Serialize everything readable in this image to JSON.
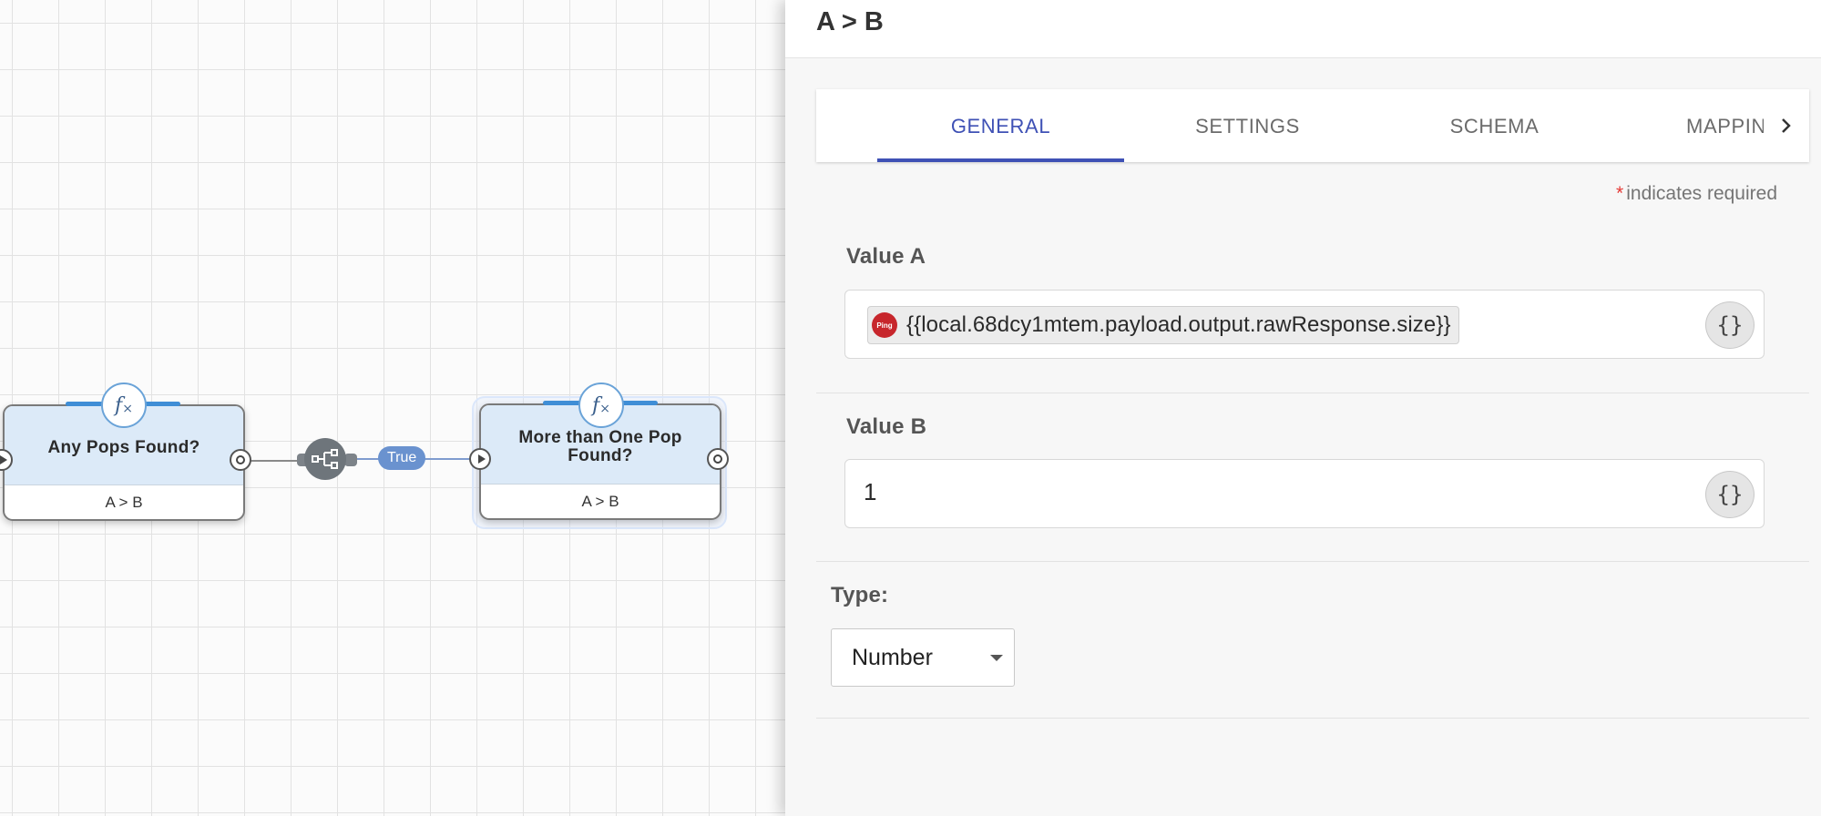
{
  "canvas": {
    "nodes": [
      {
        "title": "Any Pops Found?",
        "subtitle": "A > B",
        "icon": "fx-icon",
        "selected": false
      },
      {
        "title": "More than One Pop Found?",
        "subtitle": "A > B",
        "icon": "fx-icon",
        "selected": true
      }
    ],
    "connector_label": "True",
    "branch_icon": "branch-icon"
  },
  "panel": {
    "title": "A > B",
    "tabs": [
      {
        "label": "GENERAL",
        "active": true
      },
      {
        "label": "SETTINGS",
        "active": false
      },
      {
        "label": "SCHEMA",
        "active": false
      },
      {
        "label": "MAPPINGS",
        "active": false
      }
    ],
    "required_note": "indicates required",
    "required_marker": "*",
    "value_a": {
      "label": "Value A",
      "chip_logo_text": "Ping",
      "chip_text": "{{local.68dcy1mtem.payload.output.rawResponse.size}}",
      "brace_button": "{}"
    },
    "value_b": {
      "label": "Value B",
      "value": "1",
      "brace_button": "{}"
    },
    "type": {
      "label": "Type:",
      "selected": "Number"
    }
  },
  "colors": {
    "accent": "#3f51b5",
    "node_header": "#dceaf8",
    "connector_pill": "#6a92cf",
    "required_star": "#e53935",
    "ping_logo": "#c7262c"
  }
}
